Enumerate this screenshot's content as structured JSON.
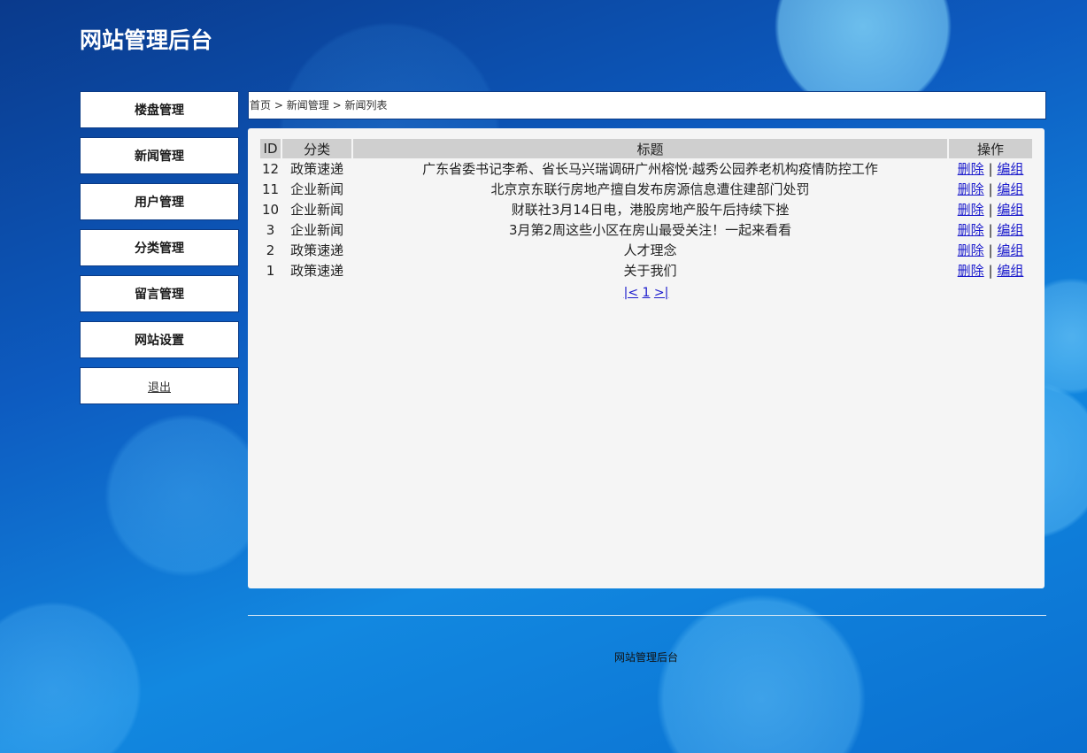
{
  "header": {
    "title": "网站管理后台"
  },
  "sidebar": {
    "items": [
      {
        "label": "楼盘管理"
      },
      {
        "label": "新闻管理"
      },
      {
        "label": "用户管理"
      },
      {
        "label": "分类管理"
      },
      {
        "label": "留言管理"
      },
      {
        "label": "网站设置"
      }
    ],
    "logout": "退出"
  },
  "breadcrumb": {
    "home": "首页",
    "sep": ">",
    "section": "新闻管理",
    "page": "新闻列表"
  },
  "table": {
    "headers": {
      "id": "ID",
      "category": "分类",
      "title": "标题",
      "actions": "操作"
    },
    "rows": [
      {
        "id": "12",
        "category": "政策速递",
        "title": "广东省委书记李希、省长马兴瑞调研广州榕悦·越秀公园养老机构疫情防控工作"
      },
      {
        "id": "11",
        "category": "企业新闻",
        "title": "北京京东联行房地产擅自发布房源信息遭住建部门处罚"
      },
      {
        "id": "10",
        "category": "企业新闻",
        "title": "财联社3月14日电，港股房地产股午后持续下挫"
      },
      {
        "id": "3",
        "category": "企业新闻",
        "title": "3月第2周这些小区在房山最受关注！一起来看看"
      },
      {
        "id": "2",
        "category": "政策速递",
        "title": "人才理念"
      },
      {
        "id": "1",
        "category": "政策速递",
        "title": "关于我们"
      }
    ],
    "delete_label": "删除",
    "edit_label": "编组",
    "action_sep": "|"
  },
  "pager": {
    "first": "|<",
    "page": "1",
    "last": ">|"
  },
  "footer": {
    "text": "网站管理后台"
  },
  "colors": {
    "panel_bg": "#f5f5f5",
    "header_bg": "#cfcfcf",
    "link": "#1a1acc"
  }
}
